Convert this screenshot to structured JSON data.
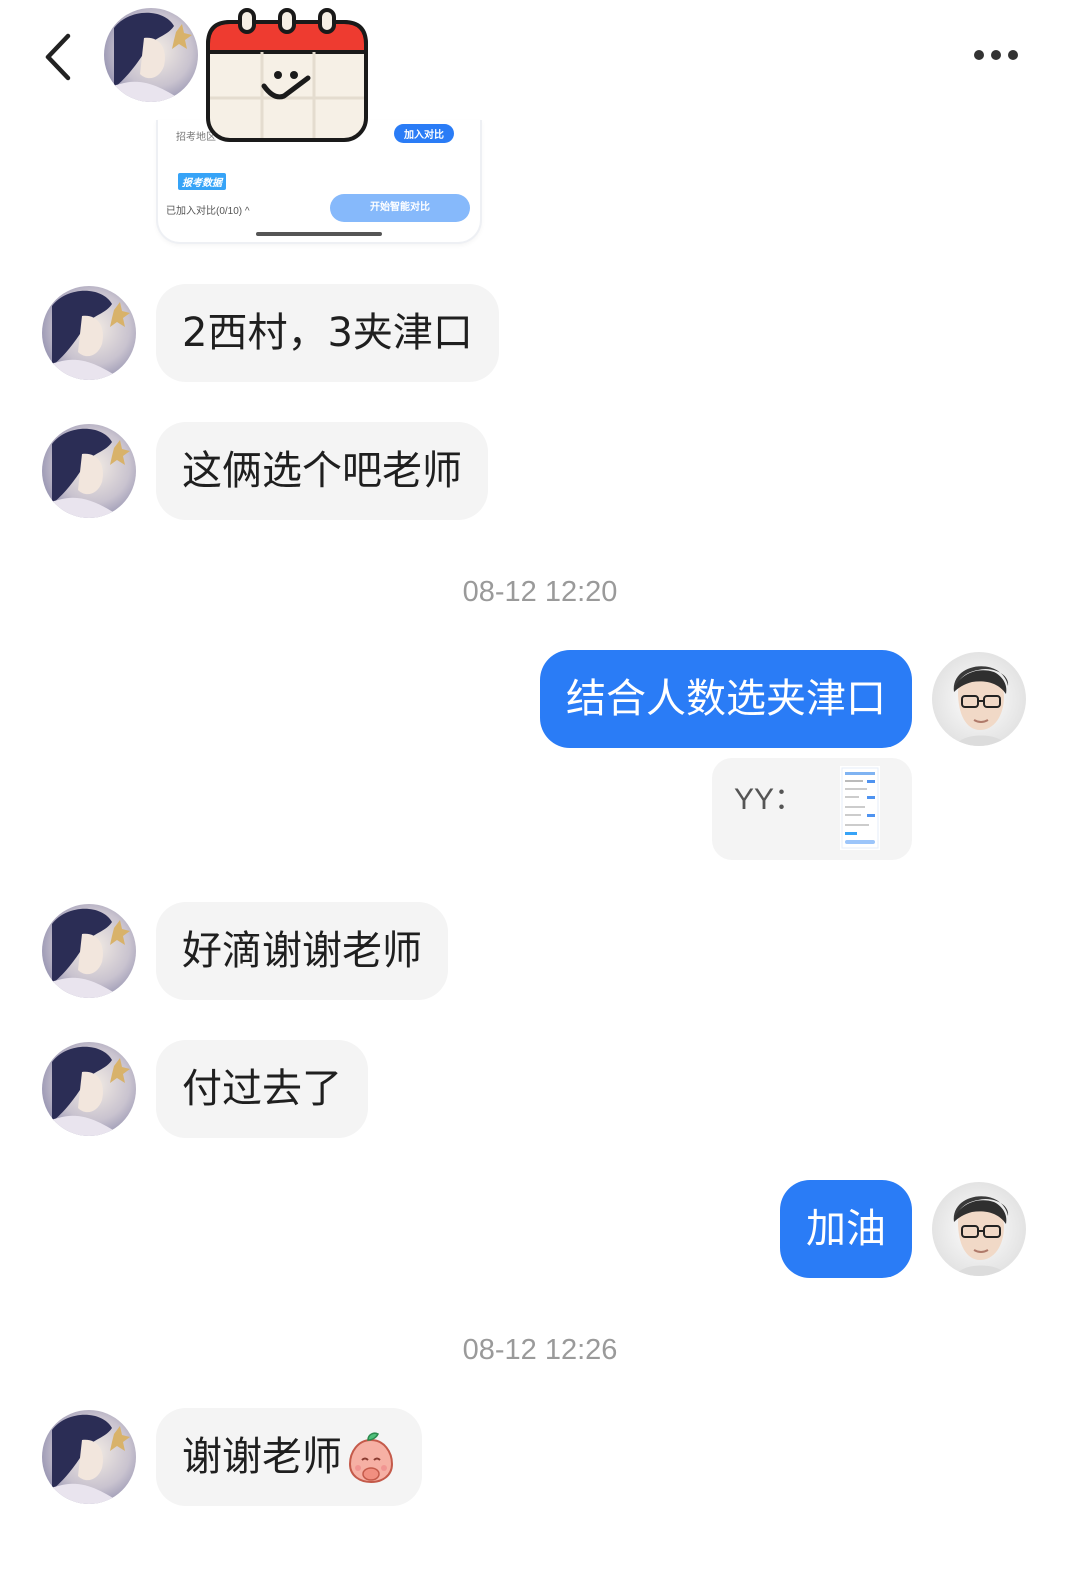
{
  "header": {
    "back_icon": "chevron-left-icon",
    "more_icon": "more-horizontal-icon"
  },
  "card_preview": {
    "region_label": "招考地区",
    "compare_add": "加入对比",
    "tag": "报考数据",
    "added_count": "已加入对比(0/10) ^",
    "start_compare": "开始智能对比"
  },
  "messages": [
    {
      "side": "left",
      "text": "2西村，3夹津口"
    },
    {
      "side": "left",
      "text": "这俩选个吧老师"
    },
    {
      "type": "time",
      "text": "08-12 12:20"
    },
    {
      "side": "right",
      "text": "结合人数选夹津口"
    },
    {
      "type": "quote",
      "name": "YY："
    },
    {
      "side": "left",
      "text": "好滴谢谢老师"
    },
    {
      "side": "left",
      "text": "付过去了"
    },
    {
      "side": "right",
      "text": "加油"
    },
    {
      "type": "time",
      "text": "08-12 12:26"
    },
    {
      "side": "left",
      "text": "谢谢老师",
      "emoji": "peach-pray-emoji"
    }
  ],
  "colors": {
    "accent": "#2a7cf6",
    "left_bubble": "#f4f4f4",
    "timestamp": "#9a9a9a"
  }
}
